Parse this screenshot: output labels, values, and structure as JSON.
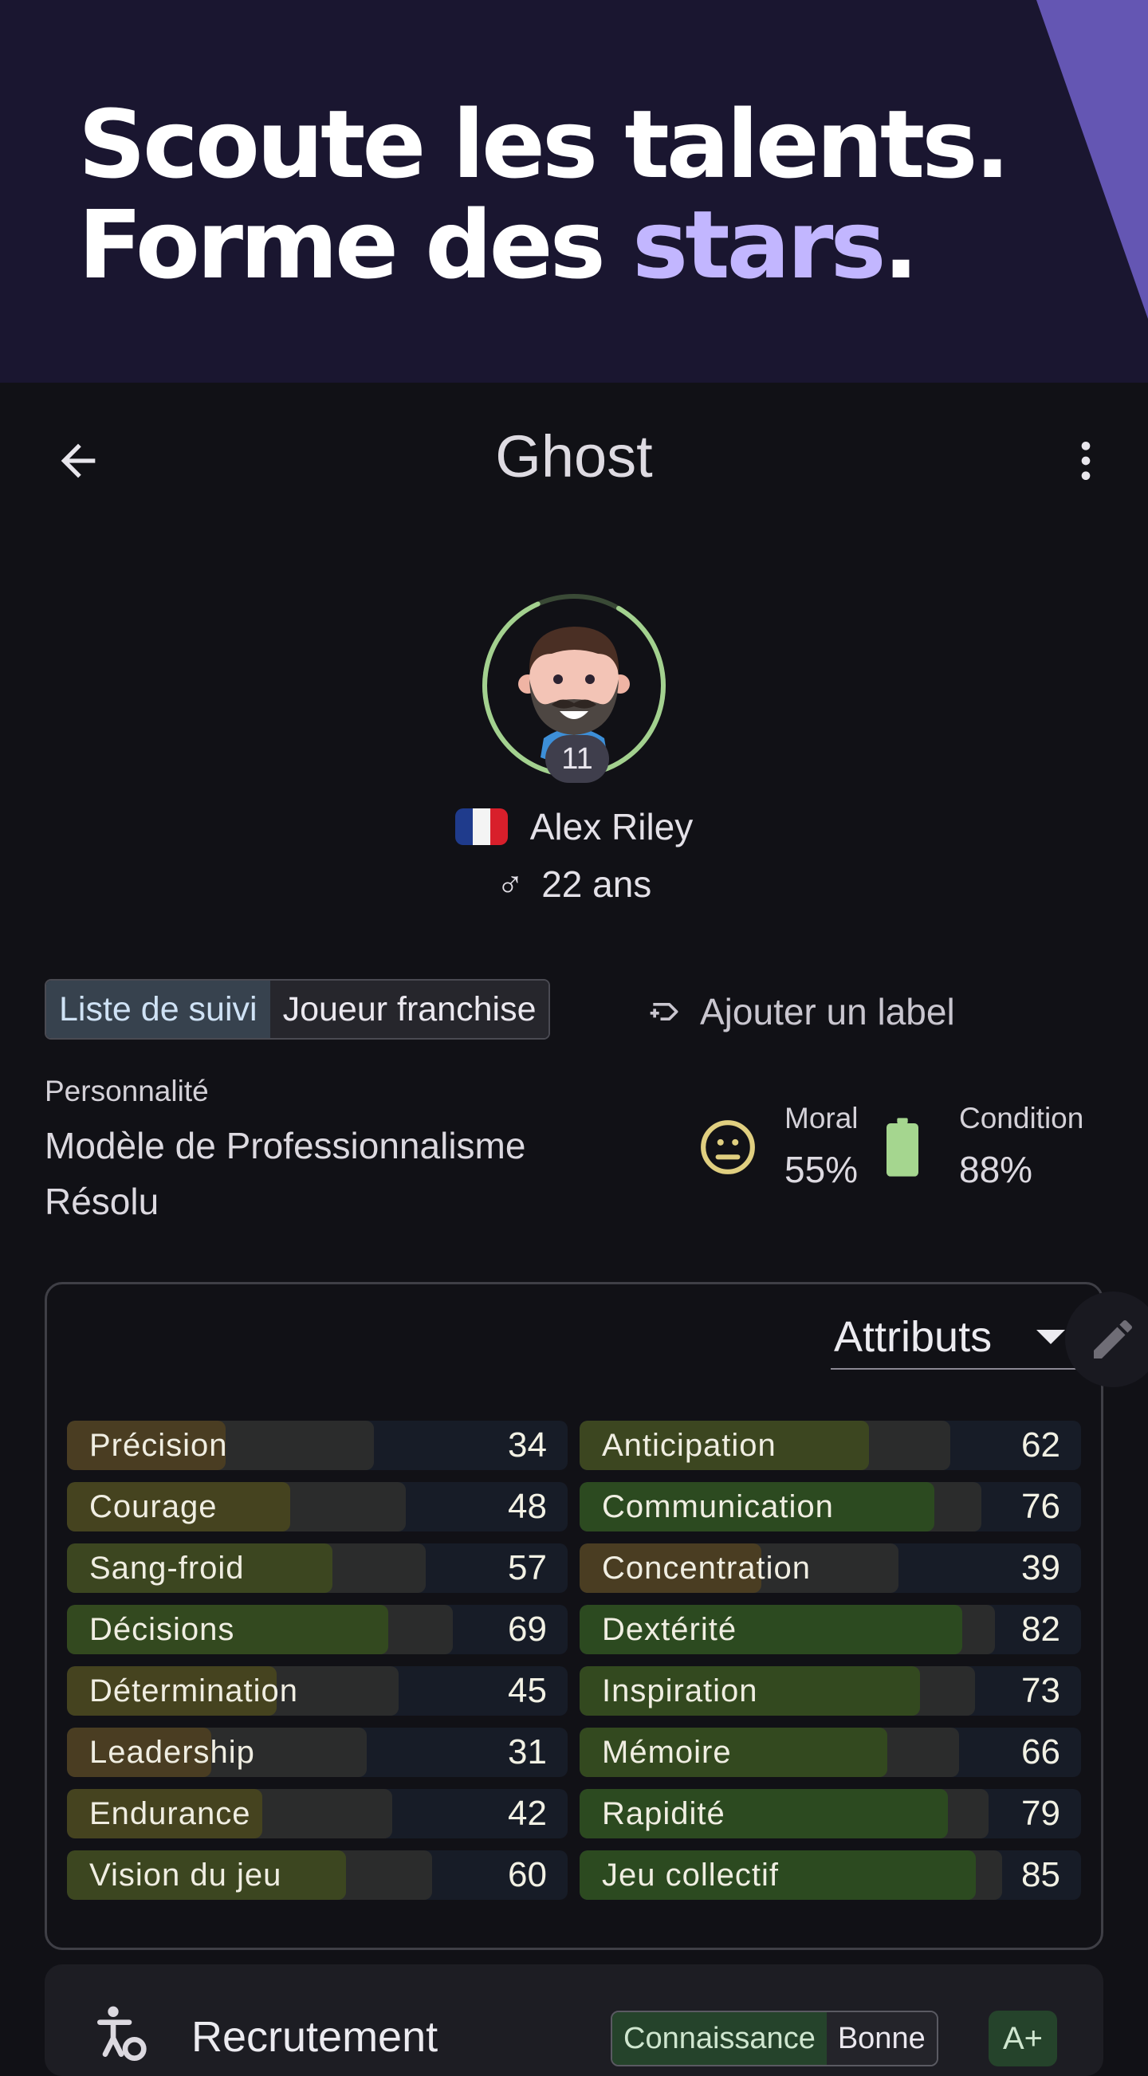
{
  "hero": {
    "line1": "Scoute les talents.",
    "line2_prefix": "Forme des ",
    "line2_accent": "stars",
    "line2_suffix": ".",
    "accent_color": "#c2b6ff",
    "background": "#1a1630"
  },
  "appbar": {
    "title": "Ghost",
    "back_icon": "arrow-left-icon",
    "menu_icon": "more-vert-icon"
  },
  "player": {
    "jersey_number": "11",
    "name": "Alex Riley",
    "nationality_flag": "france-flag",
    "gender_symbol": "♂",
    "age": "22 ans",
    "rating_ring_progress": 0.85
  },
  "labels": {
    "items": [
      {
        "text": "Liste de suivi",
        "selected": true
      },
      {
        "text": "Joueur franchise",
        "selected": false
      }
    ],
    "add_label": "Ajouter un label"
  },
  "personality": {
    "caption": "Personnalité",
    "value": "Modèle de Professionnalisme Résolu"
  },
  "status": {
    "moral_caption": "Moral",
    "moral_value": "55%",
    "condition_caption": "Condition",
    "condition_value": "88%",
    "moral_icon": "neutral-face-icon",
    "condition_icon": "battery-icon"
  },
  "attributes": {
    "dropdown_label": "Attributs",
    "left": [
      {
        "label": "Précision",
        "value": 34
      },
      {
        "label": "Courage",
        "value": 48
      },
      {
        "label": "Sang-froid",
        "value": 57
      },
      {
        "label": "Décisions",
        "value": 69
      },
      {
        "label": "Détermination",
        "value": 45
      },
      {
        "label": "Leadership",
        "value": 31
      },
      {
        "label": "Endurance",
        "value": 42
      },
      {
        "label": "Vision du jeu",
        "value": 60
      }
    ],
    "right": [
      {
        "label": "Anticipation",
        "value": 62
      },
      {
        "label": "Communication",
        "value": 76
      },
      {
        "label": "Concentration",
        "value": 39
      },
      {
        "label": "Dextérité",
        "value": 82
      },
      {
        "label": "Inspiration",
        "value": 73
      },
      {
        "label": "Mémoire",
        "value": 66
      },
      {
        "label": "Rapidité",
        "value": 79
      },
      {
        "label": "Jeu collectif",
        "value": 85
      }
    ]
  },
  "recruitment": {
    "title": "Recrutement",
    "knowledge_caption": "Connaissance",
    "knowledge_value": "Bonne",
    "grade": "A+"
  }
}
